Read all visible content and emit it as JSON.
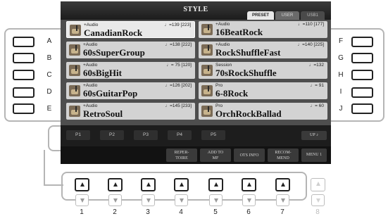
{
  "screen": {
    "title": "STYLE",
    "tabs": {
      "preset": "PRESET",
      "user": "USER",
      "usb": "USB1"
    }
  },
  "side_letters": {
    "left": [
      "A",
      "B",
      "C",
      "D",
      "E"
    ],
    "right": [
      "F",
      "G",
      "H",
      "I",
      "J"
    ]
  },
  "styles": {
    "left": [
      {
        "category": "+Audio",
        "tempo": "♩=139 [223]",
        "name": "CanadianRock",
        "selected": true
      },
      {
        "category": "+Audio",
        "tempo": "♩=138 [222]",
        "name": "60sSuperGroup",
        "selected": false
      },
      {
        "category": "+Audio",
        "tempo": "♩= 75 [120]",
        "name": "60sBigHit",
        "selected": false
      },
      {
        "category": "+Audio",
        "tempo": "♩=126 [202]",
        "name": "60sGuitarPop",
        "selected": false
      },
      {
        "category": "+Audio",
        "tempo": "♩=145 [233]",
        "name": "RetroSoul",
        "selected": false
      }
    ],
    "right": [
      {
        "category": "+Audio",
        "tempo": "♩=110 [177]",
        "name": "16BeatRock",
        "selected": false
      },
      {
        "category": "+Audio",
        "tempo": "♩=140 [225]",
        "name": "RockShuffleFast",
        "selected": false
      },
      {
        "category": "Session",
        "tempo": "♩=132",
        "name": "70sRockShuffle",
        "selected": false
      },
      {
        "category": "Pro",
        "tempo": "♩= 91",
        "name": "6-8Rock",
        "selected": false
      },
      {
        "category": "Pro",
        "tempo": "♩= 60",
        "name": "OrchRockBallad",
        "selected": false
      }
    ]
  },
  "pages": [
    "P1",
    "P2",
    "P3",
    "P4",
    "P5"
  ],
  "up_label": "UP ♪",
  "function_buttons": [
    {
      "line1": "REPER-",
      "line2": "TOIRE"
    },
    {
      "line1": "ADD TO",
      "line2": "MF"
    },
    {
      "line1": "OTS INFO",
      "line2": ""
    },
    {
      "line1": "RECOM-",
      "line2": "MEND"
    }
  ],
  "menu_label": "MENU 1",
  "bottom_numbers": [
    "1",
    "2",
    "3",
    "4",
    "5",
    "6",
    "7",
    "8"
  ]
}
